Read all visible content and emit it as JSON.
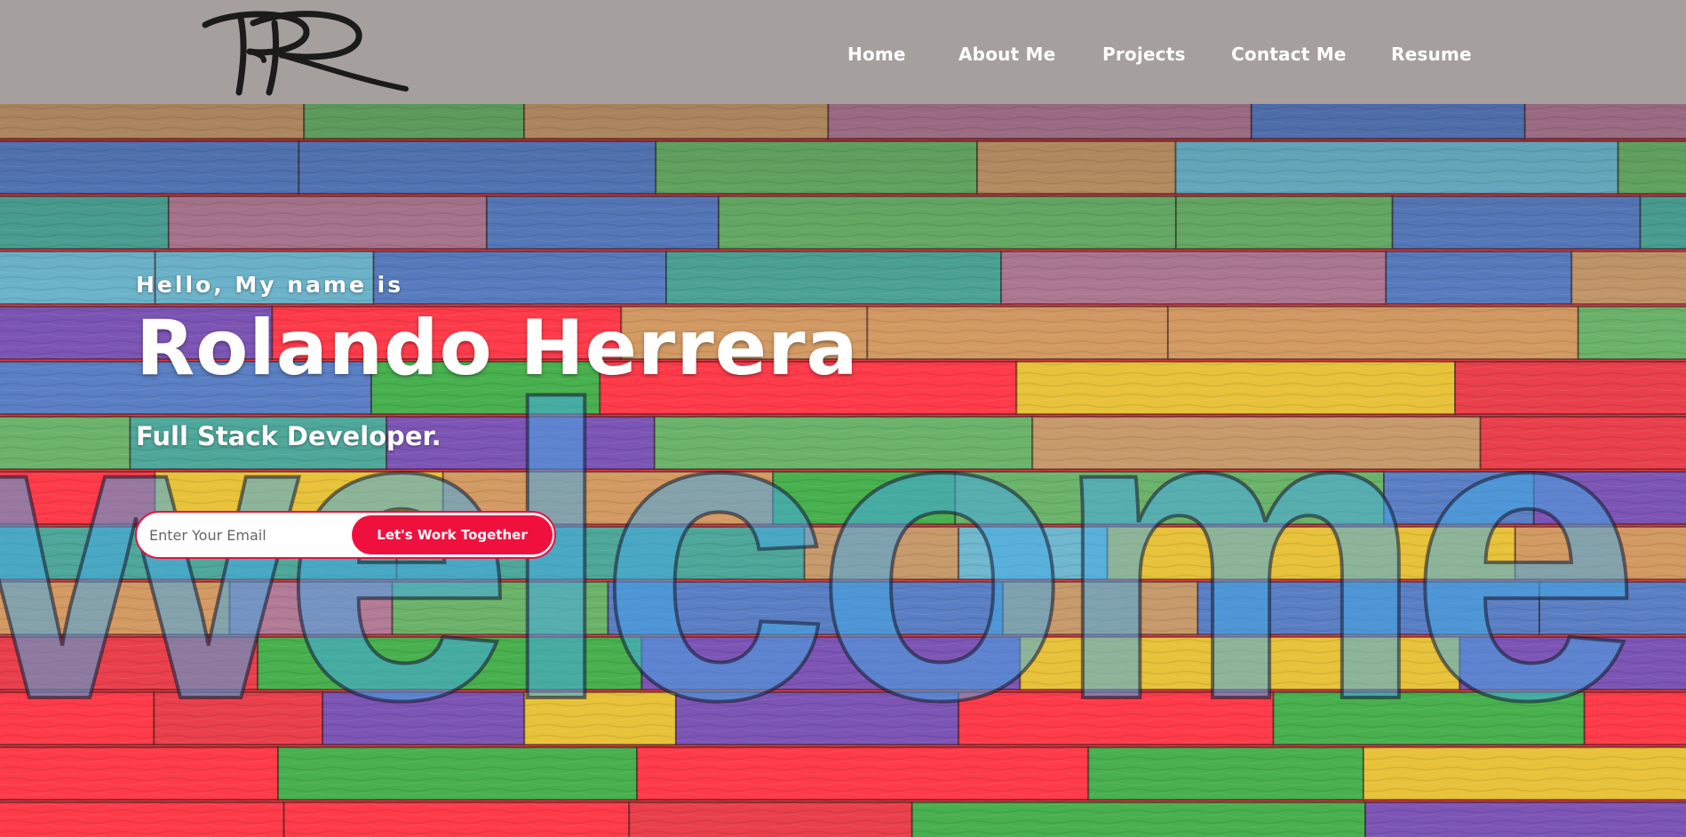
{
  "brand": {
    "logo_text": "RR"
  },
  "nav": {
    "items": [
      {
        "label": "Home"
      },
      {
        "label": "About Me"
      },
      {
        "label": "Projects"
      },
      {
        "label": "Contact Me"
      },
      {
        "label": "Resume"
      }
    ]
  },
  "hero": {
    "greeting": "Hello, My name is",
    "name": "Rolando Herrera",
    "role": "Full Stack Developer.",
    "background_word": "welcome",
    "email": {
      "placeholder": "Enter Your Email",
      "value": ""
    },
    "cta_label": "Let's Work Together"
  },
  "colors": {
    "navbar": "#a5a09e",
    "accent": "#f0103e",
    "text_light": "#ffffff"
  }
}
